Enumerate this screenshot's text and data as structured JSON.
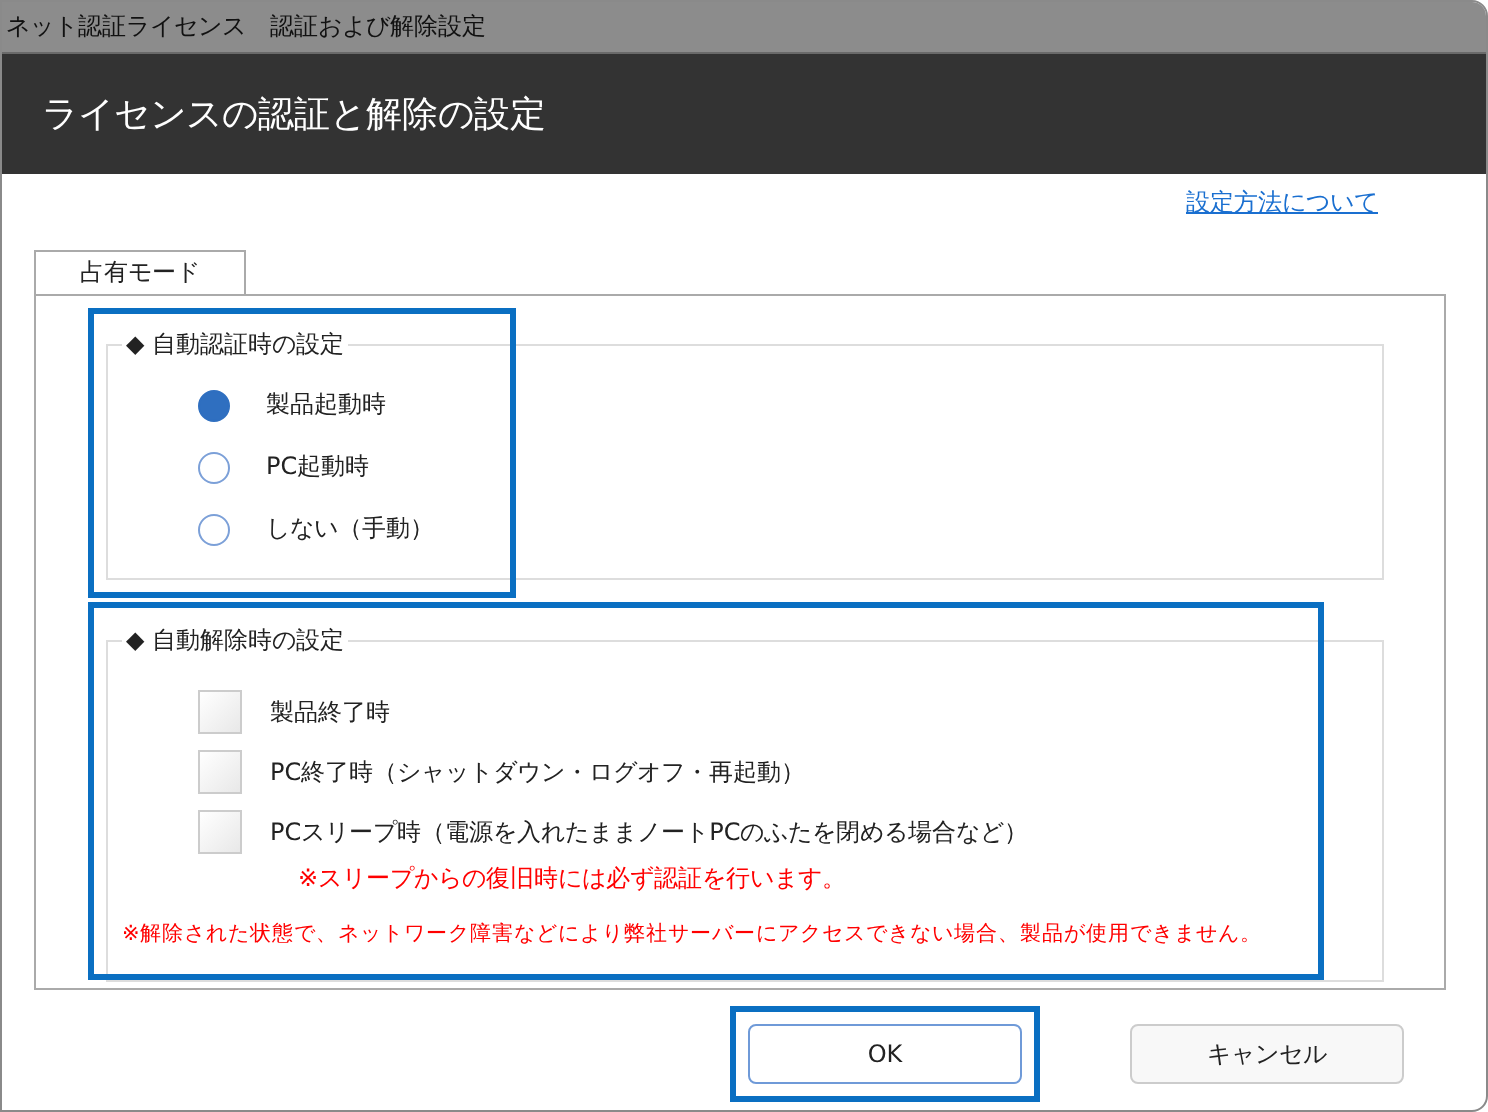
{
  "window": {
    "title": "ネット認証ライセンス　認証および解除設定"
  },
  "header": {
    "title": "ライセンスの認証と解除の設定"
  },
  "help_link": "設定方法について",
  "tabs": [
    {
      "label": "占有モード",
      "selected": true
    }
  ],
  "auto_auth": {
    "legend": "◆ 自動認証時の設定",
    "options": [
      {
        "label": "製品起動時",
        "selected": true
      },
      {
        "label": "PC起動時",
        "selected": false
      },
      {
        "label": "しない（手動）",
        "selected": false
      }
    ]
  },
  "auto_release": {
    "legend": "◆ 自動解除時の設定",
    "options": [
      {
        "label": "製品終了時",
        "checked": false
      },
      {
        "label": "PC終了時（シャットダウン・ログオフ・再起動）",
        "checked": false
      },
      {
        "label": "PCスリープ時（電源を入れたままノートPCのふたを閉める場合など）",
        "checked": false
      }
    ],
    "sub_note": "※スリープからの復旧時には必ず認証を行います。",
    "note": "※解除された状態で、ネットワーク障害などにより弊社サーバーにアクセスできない場合、製品が使用できません。"
  },
  "buttons": [
    {
      "label": "OK",
      "highlighted": true
    },
    {
      "label": "キャンセル",
      "highlighted": false
    }
  ]
}
